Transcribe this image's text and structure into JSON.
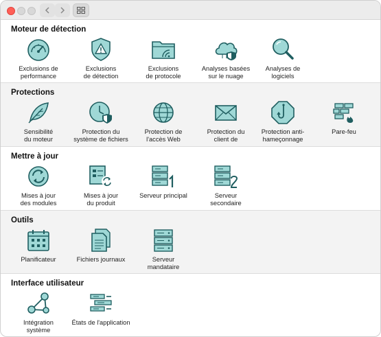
{
  "colors": {
    "icon_fill": "#9fd8d6",
    "icon_stroke": "#1f5e60",
    "accent": "#ff5f57"
  },
  "sections": [
    {
      "title": "Moteur de détection",
      "items": [
        {
          "icon": "gauge-icon",
          "label": "Exclusions de\nperformance"
        },
        {
          "icon": "shield-warning-icon",
          "label": "Exclusions\nde détection"
        },
        {
          "icon": "folder-wave-icon",
          "label": "Exclusions\nde protocole"
        },
        {
          "icon": "cloud-shield-icon",
          "label": "Analyses basées\nsur le nuage"
        },
        {
          "icon": "magnifier-icon",
          "label": "Analyses de\nlogiciels"
        }
      ]
    },
    {
      "title": "Protections",
      "items": [
        {
          "icon": "feather-icon",
          "label": "Sensibilité\ndu moteur"
        },
        {
          "icon": "clock-shield-icon",
          "label": "Protection du\nsystème de fichiers"
        },
        {
          "icon": "globe-icon",
          "label": "Protection de\nl'accès Web"
        },
        {
          "icon": "envelope-icon",
          "label": "Protection du\nclient de"
        },
        {
          "icon": "hook-octagon-icon",
          "label": "Protection anti-\nhameçonnage"
        },
        {
          "icon": "firewall-icon",
          "label": "Pare-feu"
        }
      ]
    },
    {
      "title": "Mettre à jour",
      "items": [
        {
          "icon": "refresh-icon",
          "label": "Mises à jour\ndes modules"
        },
        {
          "icon": "product-update-icon",
          "label": "Mises à jour\ndu produit"
        },
        {
          "icon": "server-one-icon",
          "label": "Serveur principal"
        },
        {
          "icon": "server-two-icon",
          "label": "Serveur\nsecondaire"
        }
      ]
    },
    {
      "title": "Outils",
      "items": [
        {
          "icon": "calendar-icon",
          "label": "Planificateur"
        },
        {
          "icon": "documents-icon",
          "label": "Fichiers journaux"
        },
        {
          "icon": "server-stack-icon",
          "label": "Serveur\nmandataire"
        }
      ]
    },
    {
      "title": "Interface utilisateur",
      "items": [
        {
          "icon": "integration-icon",
          "label": "Intégration\nsystème"
        },
        {
          "icon": "app-states-icon",
          "label": "États de l'application"
        }
      ]
    }
  ]
}
